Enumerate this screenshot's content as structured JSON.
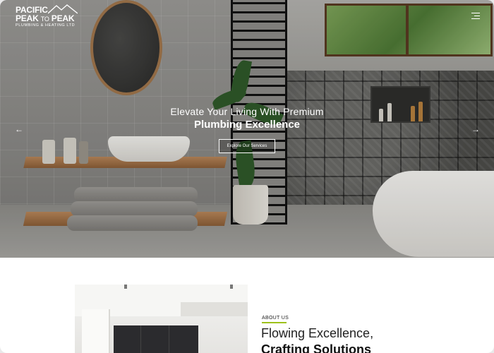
{
  "header": {
    "logo": {
      "line1": "PACIFIC",
      "line2_a": "PEAK",
      "line2_b": "TO",
      "line2_c": "PEAK",
      "line3": "PLUMBING & HEATING LTD"
    },
    "menu_icon": "hamburger-icon"
  },
  "hero": {
    "subtitle": "Elevate Your Living With Premium",
    "title": "Plumbing Excellence",
    "cta_label": "Explore Our Services",
    "prev_icon": "arrow-left-icon",
    "next_icon": "arrow-right-icon",
    "prev_glyph": "←",
    "next_glyph": "→"
  },
  "about": {
    "label": "ABOUT US",
    "heading_line1": "Flowing Excellence,",
    "heading_line2": "Crafting Solutions",
    "accent_color": "#9dc11a"
  },
  "colors": {
    "hero_text": "#ffffff",
    "page_bg": "#ffffff",
    "accent": "#9dc11a"
  }
}
